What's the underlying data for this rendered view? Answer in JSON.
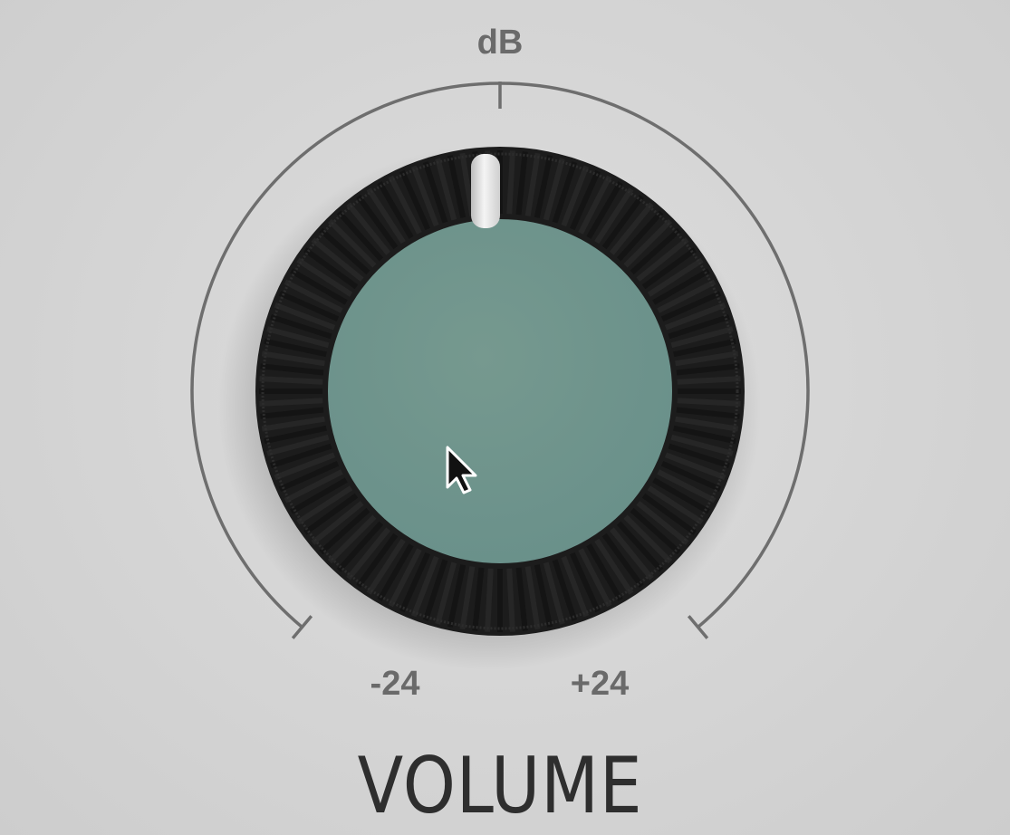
{
  "volume_control": {
    "unit": "dB",
    "min_label": "-24",
    "max_label": "+24",
    "title": "VOLUME",
    "value_db": 0,
    "min_db": -24,
    "max_db": 24
  },
  "colors": {
    "background": "#d6d6d6",
    "scale_line": "#6e6e6e",
    "knob_outer": "#1c1c1c",
    "knob_face": "#6f958c",
    "indicator": "#e8e8e8",
    "title_text": "#2e2e2e",
    "label_text": "#6a6a6a"
  },
  "cursor": {
    "icon": "arrow-cursor-icon"
  }
}
